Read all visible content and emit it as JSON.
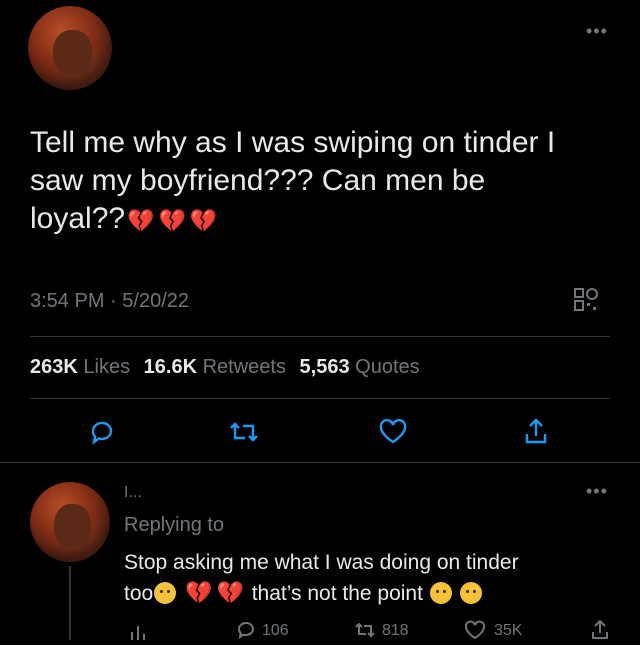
{
  "tweet": {
    "text_lines": [
      "Tell me why as I was swiping on tinder I",
      "saw my boyfriend??? Can men be",
      "loyal??"
    ],
    "time": "3:54 PM",
    "separator": "·",
    "date": "5/20/22",
    "likes_count": "263K",
    "likes_label": "Likes",
    "retweets_count": "16.6K",
    "retweets_label": "Retweets",
    "quotes_count": "5,563",
    "quotes_label": "Quotes",
    "more_icon": "•••"
  },
  "reply": {
    "author_partial": "I...",
    "replying_to": "Replying to",
    "text_line1": "Stop asking me what I was doing on tinder",
    "text_line2_start": "too",
    "text_line2_middle": "that’s not the point",
    "reply_count": "106",
    "retweet_count": "818",
    "like_count": "35K",
    "more_icon": "•••"
  },
  "icons": {
    "broken_heart": "💔",
    "accent": "#1d9bf0",
    "heart_red": "#e0245e"
  }
}
